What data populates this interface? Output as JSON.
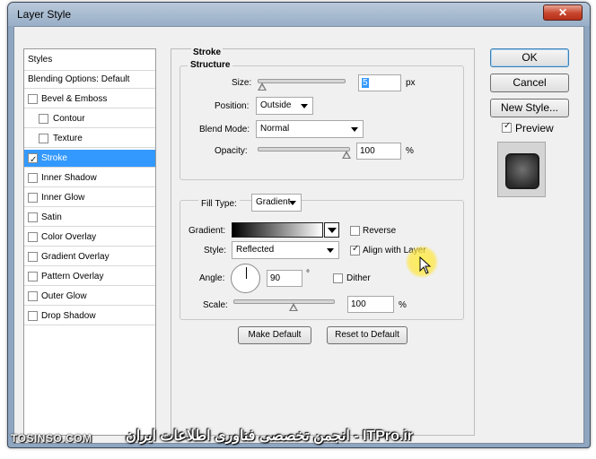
{
  "window": {
    "title": "Layer Style",
    "close_glyph": "✕"
  },
  "styles_list": {
    "header": "Styles",
    "items": [
      {
        "label": "Blending Options: Default",
        "checkbox": false,
        "checked": false
      },
      {
        "label": "Bevel & Emboss",
        "checkbox": true,
        "checked": false
      },
      {
        "label": "Contour",
        "checkbox": true,
        "checked": false,
        "indent": true
      },
      {
        "label": "Texture",
        "checkbox": true,
        "checked": false,
        "indent": true
      },
      {
        "label": "Stroke",
        "checkbox": true,
        "checked": true,
        "selected": true
      },
      {
        "label": "Inner Shadow",
        "checkbox": true,
        "checked": false
      },
      {
        "label": "Inner Glow",
        "checkbox": true,
        "checked": false
      },
      {
        "label": "Satin",
        "checkbox": true,
        "checked": false
      },
      {
        "label": "Color Overlay",
        "checkbox": true,
        "checked": false
      },
      {
        "label": "Gradient Overlay",
        "checkbox": true,
        "checked": false
      },
      {
        "label": "Pattern Overlay",
        "checkbox": true,
        "checked": false
      },
      {
        "label": "Outer Glow",
        "checkbox": true,
        "checked": false
      },
      {
        "label": "Drop Shadow",
        "checkbox": true,
        "checked": false
      }
    ]
  },
  "stroke": {
    "section_title": "Stroke",
    "structure": {
      "title": "Structure",
      "size_label": "Size:",
      "size_value": "5",
      "size_unit": "px",
      "size_slider_fraction": 0.02,
      "position_label": "Position:",
      "position_value": "Outside",
      "blend_mode_label": "Blend Mode:",
      "blend_mode_value": "Normal",
      "opacity_label": "Opacity:",
      "opacity_value": "100",
      "opacity_unit": "%",
      "opacity_slider_fraction": 1.0
    },
    "fill": {
      "fill_type_label": "Fill Type:",
      "fill_type_value": "Gradient",
      "gradient_label": "Gradient:",
      "reverse_label": "Reverse",
      "reverse_checked": false,
      "style_label": "Style:",
      "style_value": "Reflected",
      "align_label": "Align with Layer",
      "align_checked": true,
      "angle_label": "Angle:",
      "angle_value": "90",
      "angle_unit": "°",
      "dither_label": "Dither",
      "dither_checked": false,
      "scale_label": "Scale:",
      "scale_value": "100",
      "scale_unit": "%",
      "scale_slider_fraction": 0.5
    },
    "make_default_label": "Make Default",
    "reset_default_label": "Reset to Default"
  },
  "right_buttons": {
    "ok_label": "OK",
    "cancel_label": "Cancel",
    "new_style_label": "New Style...",
    "preview_label": "Preview",
    "preview_checked": true
  },
  "watermarks": {
    "left": "TOSINSO.COM",
    "right": "انجمن تخصصی فناوری اطلاعات ایران - ITPro.ir"
  }
}
